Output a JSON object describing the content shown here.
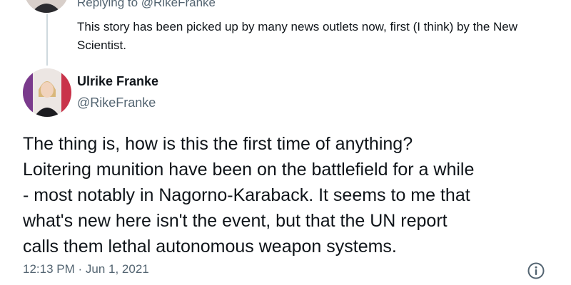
{
  "reply_context": {
    "replying_prefix": "Replying to",
    "replying_handle": "@RikeFranke",
    "text": "This story has been picked up by many news outlets now, first (I think) by the New Scientist."
  },
  "tweet": {
    "author_name": "Ulrike Franke",
    "author_handle": "@RikeFranke",
    "lines": [
      "The thing is, how is this the first time of anything?",
      "Loitering munition have been on the battlefield for a while",
      "- most notably in Nagorno-Karaback. It seems to me that",
      "what's new here isn't the event, but that the UN report",
      "calls them lethal autonomous weapon systems."
    ],
    "timestamp": "12:13 PM · Jun 1, 2021"
  },
  "icons": {
    "info": "info-icon",
    "avatar": "avatar"
  },
  "colors": {
    "text": "#0f1419",
    "secondary": "#536471",
    "thread_line": "#cfd9de",
    "background": "#ffffff"
  }
}
